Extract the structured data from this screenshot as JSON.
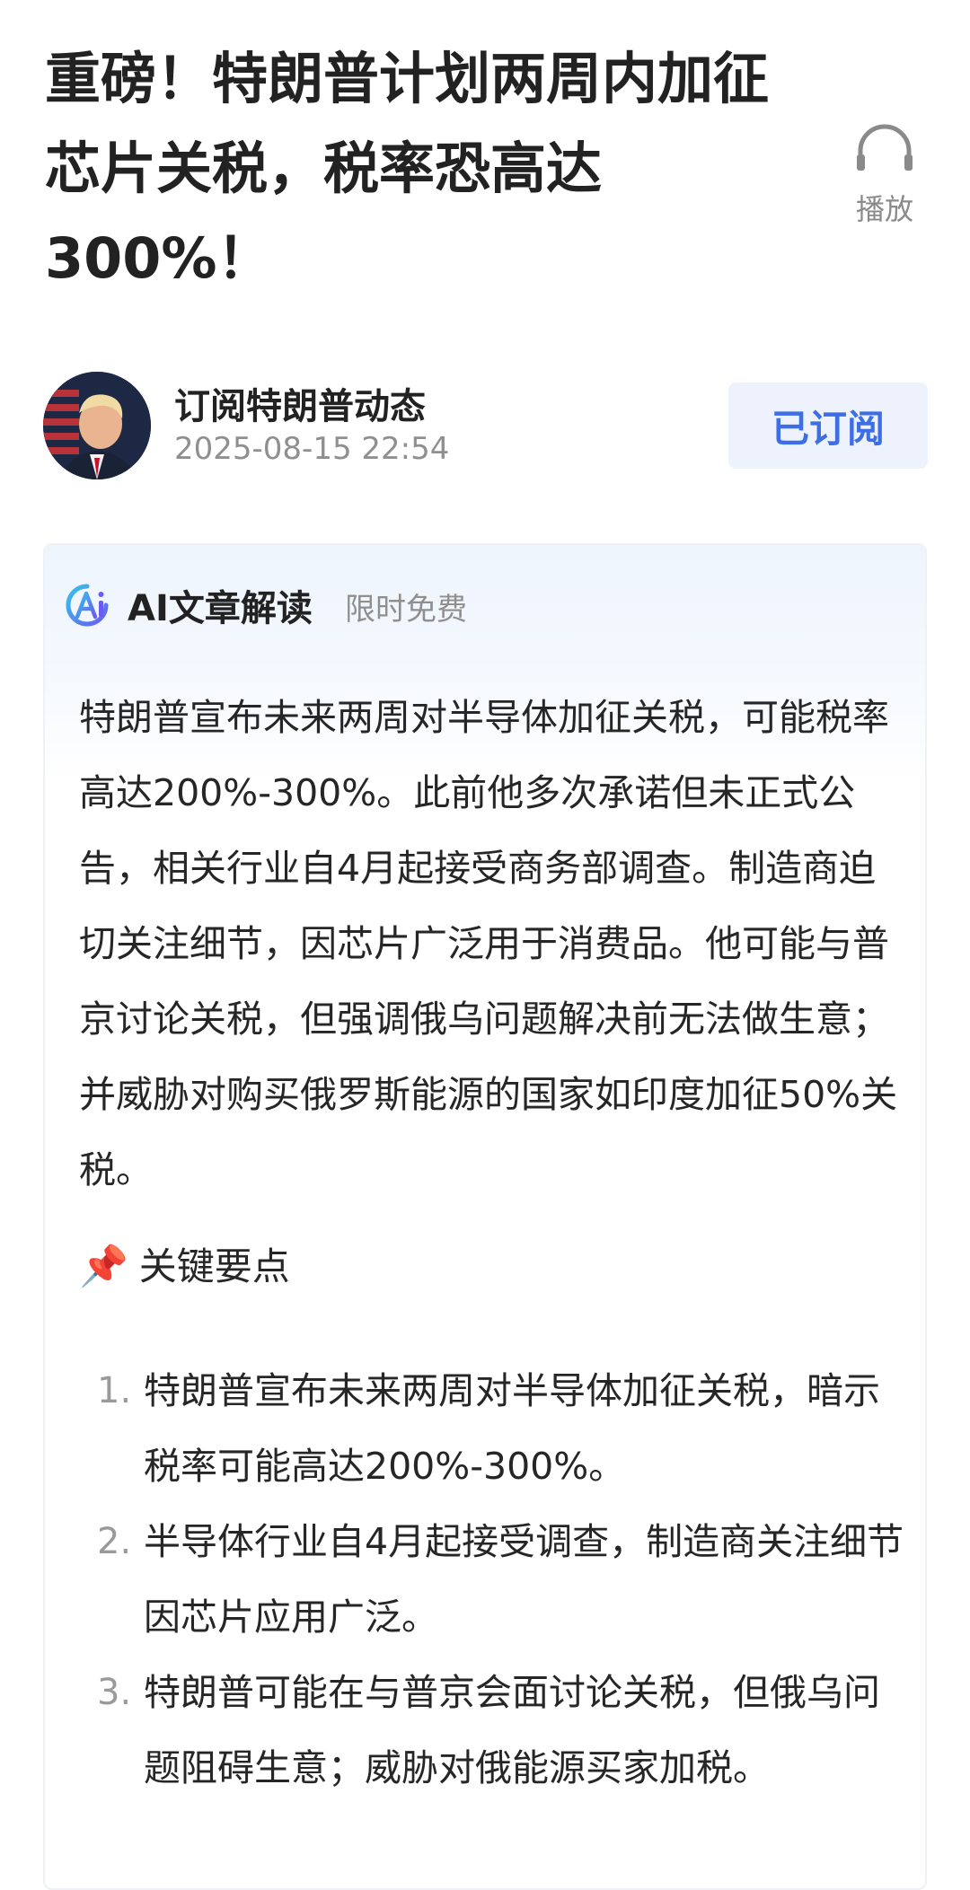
{
  "article": {
    "title": "重磅！特朗普计划两周内加征芯片关税，税率恐高达300%！",
    "play_label": "播放"
  },
  "author": {
    "name": "订阅特朗普动态",
    "timestamp": "2025-08-15 22:54",
    "subscribe_label": "已订阅"
  },
  "ai_reading": {
    "title": "AI文章解读",
    "tag": "限时免费",
    "summary": "特朗普宣布未来两周对半导体加征关税，可能税率高达200%-300%。此前他多次承诺但未正式公告，相关行业自4月起接受商务部调查。制造商迫切关注细节，因芯片广泛用于消费品。他可能与普京讨论关税，但强调俄乌问题解决前无法做生意；并威胁对购买俄罗斯能源的国家如印度加征50%关税。",
    "key_points_heading": "关键要点",
    "key_points_icon": "📌",
    "key_points": [
      {
        "num": "1.",
        "text": "特朗普宣布未来两周对半导体加征关税，暗示税率可能高达200%-300%。"
      },
      {
        "num": "2.",
        "text": "半导体行业自4月起接受调查，制造商关注细节因芯片应用广泛。"
      },
      {
        "num": "3.",
        "text": "特朗普可能在与普京会面讨论关税，但俄乌问题阻碍生意；威胁对俄能源买家加税。"
      }
    ]
  },
  "colors": {
    "subscribe_text": "#3d6ee6",
    "subscribe_bg": "#edf2fd",
    "muted_text": "#8f8f8f"
  },
  "icons": {
    "play": "headphones-icon",
    "ai_logo": "ai-logo-icon",
    "pin": "pushpin-icon"
  }
}
